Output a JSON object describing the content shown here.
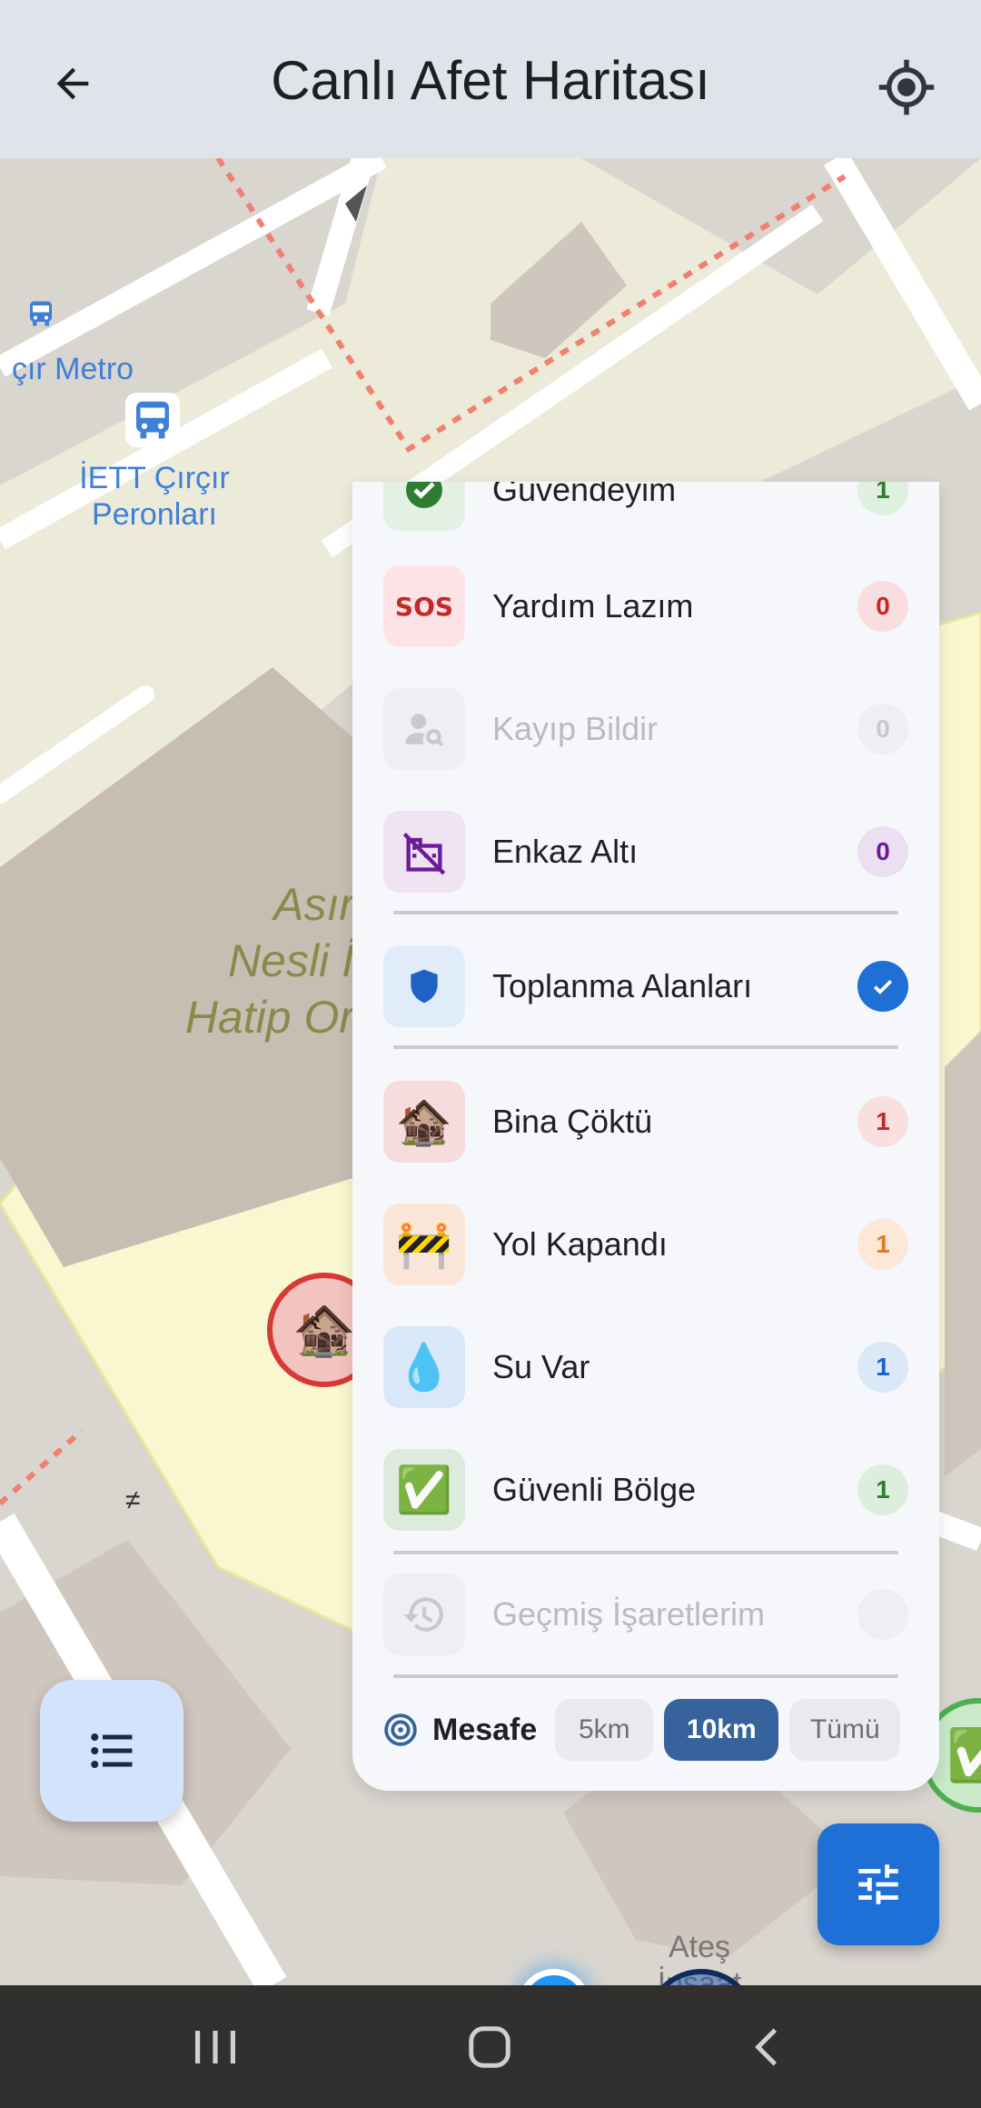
{
  "appbar": {
    "title": "Canlı Afet Haritası",
    "back_icon": "arrow-left-icon",
    "locate_icon": "crosshair-icon"
  },
  "map": {
    "labels": {
      "metro": "çır Metro",
      "iett": "İETT Çırçır\nPeronları",
      "school": "Asır\nNesli İ\nHatip Or",
      "construction": "Ateş\nİnşaat"
    },
    "markers": {
      "red_emoji": "🏚️",
      "green_emoji": "✅"
    }
  },
  "filter_panel": {
    "items": [
      {
        "key": "safe",
        "label": "Güvendeyim",
        "count": "1",
        "emoji": "✔",
        "bg": "#e2f1e3",
        "count_bg": "#dff0e0",
        "count_color": "#2e7d32",
        "enabled": true
      },
      {
        "key": "help",
        "label": "Yardım Lazım",
        "count": "0",
        "emoji": "SOS",
        "bg": "#fde3e6",
        "count_bg": "#fadde0",
        "count_color": "#c62828",
        "enabled": true
      },
      {
        "key": "missing",
        "label": "Kayıp Bildir",
        "count": "0",
        "emoji": "person-search-icon",
        "bg": "#eeeff2",
        "count_bg": "#eeeff2",
        "count_color": "#c8c9cf",
        "enabled": false
      },
      {
        "key": "rubble",
        "label": "Enkaz Altı",
        "count": "0",
        "emoji": "domain-disabled-icon",
        "bg": "#efe2f3",
        "count_bg": "#ecdff1",
        "count_color": "#6a1b9a",
        "enabled": true
      },
      {
        "key": "assembly",
        "label": "Toplanma Alanları",
        "checked": true,
        "emoji": "shield-icon",
        "bg": "#e0ecfa",
        "enabled": true
      },
      {
        "key": "collapsed",
        "label": "Bina Çöktü",
        "count": "1",
        "emoji": "🏚️",
        "bg": "#f6dcdc",
        "count_bg": "#f8dfe0",
        "count_color": "#c62828",
        "enabled": true
      },
      {
        "key": "road",
        "label": "Yol Kapandı",
        "count": "1",
        "emoji": "🚧",
        "bg": "#fae6d8",
        "count_bg": "#fbe8d8",
        "count_color": "#e07b20",
        "enabled": true
      },
      {
        "key": "water",
        "label": "Su Var",
        "count": "1",
        "emoji": "💧",
        "bg": "#d8e8f8",
        "count_bg": "#dbe8f8",
        "count_color": "#1e62c4",
        "enabled": true
      },
      {
        "key": "safe_zone",
        "label": "Güvenli Bölge",
        "count": "1",
        "emoji": "✅",
        "bg": "#dcebdc",
        "count_bg": "#dcefdd",
        "count_color": "#2e7d32",
        "enabled": true
      },
      {
        "key": "history",
        "label": "Geçmiş İşaretlerim",
        "emoji": "history-icon",
        "bg": "#eeeff2",
        "enabled": false
      }
    ],
    "distance": {
      "label": "Mesafe",
      "options": [
        "5km",
        "10km",
        "Tümü"
      ],
      "selected": "10km"
    }
  },
  "sysnav": {
    "recents_icon": "recents-icon",
    "home_icon": "home-icon",
    "back_icon": "back-icon"
  }
}
